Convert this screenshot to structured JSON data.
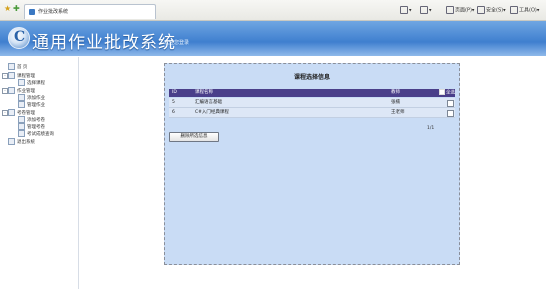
{
  "browser": {
    "tab_title": "作业批改系统",
    "tools": {
      "page": "页面(P)",
      "safety": "安全(S)",
      "tools": "工具(O)"
    }
  },
  "header": {
    "title": "通用作业批改系统",
    "subtitle": "欢迎您登录"
  },
  "sidebar": {
    "items": [
      {
        "label": "首 页",
        "level": 0,
        "toggle": ""
      },
      {
        "label": "课程管理",
        "level": 0,
        "toggle": "-"
      },
      {
        "label": "选择课程",
        "level": 1,
        "toggle": ""
      },
      {
        "label": "作业管理",
        "level": 0,
        "toggle": "-"
      },
      {
        "label": "添加作业",
        "level": 1,
        "toggle": ""
      },
      {
        "label": "管理作业",
        "level": 1,
        "toggle": ""
      },
      {
        "label": "考卷管理",
        "level": 0,
        "toggle": "-"
      },
      {
        "label": "添加考卷",
        "level": 1,
        "toggle": ""
      },
      {
        "label": "管理考卷",
        "level": 1,
        "toggle": ""
      },
      {
        "label": "考试成绩查询",
        "level": 1,
        "toggle": ""
      },
      {
        "label": "退出系统",
        "level": 0,
        "toggle": ""
      }
    ]
  },
  "panel": {
    "title": "课程选择信息",
    "columns": {
      "id": "ID",
      "course": "课程名称",
      "teacher": "教师",
      "select_all": "全选"
    },
    "rows": [
      {
        "id": "5",
        "course": "汇编语言基础",
        "teacher": "张楠"
      },
      {
        "id": "6",
        "course": "C#入门经典课程",
        "teacher": "王老师"
      }
    ],
    "pager": "1/1",
    "delete_button": "删除所选信息"
  }
}
